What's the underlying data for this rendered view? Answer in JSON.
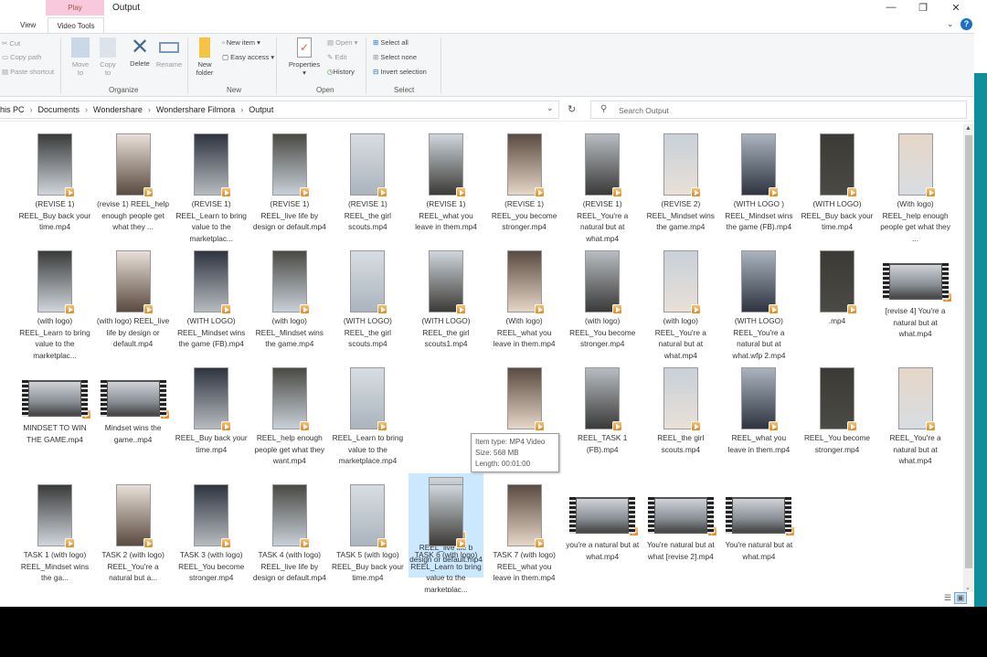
{
  "window": {
    "title": "Output",
    "contextual_group": "Play",
    "tabs": [
      "View",
      "Video Tools"
    ],
    "controls": [
      "—",
      "❐",
      "✕"
    ],
    "help": "?"
  },
  "ribbon": {
    "clipboard": {
      "cut": "Cut",
      "copy_path": "Copy path",
      "paste_shortcut": "Paste shortcut"
    },
    "organize": {
      "label": "Organize",
      "move_to": "Move to",
      "copy_to": "Copy to",
      "delete": "Delete",
      "rename": "Rename"
    },
    "new": {
      "label": "New",
      "new_folder": "New folder",
      "new_item": "New item",
      "easy_access": "Easy access"
    },
    "open": {
      "label": "Open",
      "properties": "Properties",
      "open": "Open",
      "edit": "Edit",
      "history": "History"
    },
    "select": {
      "label": "Select",
      "select_all": "Select all",
      "select_none": "Select none",
      "invert": "Invert selection"
    }
  },
  "breadcrumb": [
    "his PC",
    "Documents",
    "Wondershare",
    "Wondershare Filmora",
    "Output"
  ],
  "search": {
    "placeholder": "Search Output"
  },
  "files": [
    {
      "name": "(REVISE 1) REEL_Buy back your time.mp4",
      "thumb": "portrait"
    },
    {
      "name": "(revise 1) REEL_help enough people get what they ...",
      "thumb": "portrait"
    },
    {
      "name": "(REVISE 1) REEL_Learn to bring value to the marketplac...",
      "thumb": "portrait"
    },
    {
      "name": "(REVISE 1) REEL_live life by design or default.mp4",
      "thumb": "portrait"
    },
    {
      "name": "(REVISE 1) REEL_the girl scouts.mp4",
      "thumb": "portrait"
    },
    {
      "name": "(REVISE 1) REEL_what you leave in them.mp4",
      "thumb": "portrait"
    },
    {
      "name": "(REVISE 1) REEL_you become stronger.mp4",
      "thumb": "portrait"
    },
    {
      "name": "(REVISE 1) REEL_You're a natural but at what.mp4",
      "thumb": "portrait"
    },
    {
      "name": "(REVISE 2) REEL_Mindset wins the game.mp4",
      "thumb": "portrait"
    },
    {
      "name": "(WITH LOGO ) REEL_Mindset wins the game (FB).mp4",
      "thumb": "portrait"
    },
    {
      "name": "(WITH LOGO) REEL_Buy back your time.mp4",
      "thumb": "portrait"
    },
    {
      "name": "(With logo) REEL_help enough people get what they ...",
      "thumb": "portrait"
    },
    {
      "name": "(with logo) REEL_Learn to bring value to the marketplac...",
      "thumb": "portrait"
    },
    {
      "name": "(with logo) REEL_live life by design or default.mp4",
      "thumb": "portrait"
    },
    {
      "name": "(WITH LOGO) REEL_Mindset wins the game (FB).mp4",
      "thumb": "portrait"
    },
    {
      "name": "(with logo) REEL_Mindset wins the game.mp4",
      "thumb": "portrait"
    },
    {
      "name": "(WITH LOGO) REEL_the girl scouts.mp4",
      "thumb": "portrait"
    },
    {
      "name": "(WITH LOGO) REEL_the girl scouts1.mp4",
      "thumb": "portrait"
    },
    {
      "name": "(With logo) REEL_what you leave in them.mp4",
      "thumb": "portrait"
    },
    {
      "name": "(with logo) REEL_You become stronger.mp4",
      "thumb": "portrait"
    },
    {
      "name": "(with logo) REEL_You're a natural but at what.mp4",
      "thumb": "portrait"
    },
    {
      "name": "(WITH LOGO) REEL_You're a natural but at what.wfp 2.mp4",
      "thumb": "portrait"
    },
    {
      "name": ".mp4",
      "thumb": "portrait"
    },
    {
      "name": "[revise 4] You're a natural but at what.mp4",
      "thumb": "landscape"
    },
    {
      "name": "MINDSET TO WIN THE GAME.mp4",
      "thumb": "landscape"
    },
    {
      "name": "Mindset wins the game..mp4",
      "thumb": "landscape"
    },
    {
      "name": "REEL_Buy back your time.mp4",
      "thumb": "portrait"
    },
    {
      "name": "REEL_help enough people get what they want.mp4",
      "thumb": "portrait"
    },
    {
      "name": "REEL_Learn to bring value to the marketplace.mp4",
      "thumb": "portrait"
    },
    {
      "name": "REEL_live life b design or default.mp4",
      "thumb": "portrait",
      "selected": true
    },
    {
      "name": "",
      "thumb": "portrait"
    },
    {
      "name": "REEL_TASK 1 (FB).mp4",
      "thumb": "portrait"
    },
    {
      "name": "REEL_the girl scouts.mp4",
      "thumb": "portrait"
    },
    {
      "name": "REEL_what you leave in them.mp4",
      "thumb": "portrait"
    },
    {
      "name": "REEL_You become stronger.mp4",
      "thumb": "portrait"
    },
    {
      "name": "REEL_You're a natural but at what.mp4",
      "thumb": "portrait"
    },
    {
      "name": "TASK 1 (with logo) REEL_Mindset wins the ga...",
      "thumb": "portrait"
    },
    {
      "name": "TASK 2 (with logo) REEL_You're a natural but a...",
      "thumb": "portrait"
    },
    {
      "name": "TASK 3 (with logo) REEL_You become stronger.mp4",
      "thumb": "portrait"
    },
    {
      "name": "TASK 4 (with logo) REEL_live life by design or default.mp4",
      "thumb": "portrait"
    },
    {
      "name": "TASK 5 (with logo) REEL_Buy back your time.mp4",
      "thumb": "portrait"
    },
    {
      "name": "TASK 6 (with logo) REEL_Learn to bring value to the marketplac...",
      "thumb": "portrait"
    },
    {
      "name": "TASK 7 (with logo) REEL_what you leave in them.mp4",
      "thumb": "portrait"
    },
    {
      "name": "you're a natural but at what.mp4",
      "thumb": "landscape"
    },
    {
      "name": "You're natural but at what [revise 2].mp4",
      "thumb": "landscape"
    },
    {
      "name": "You're natural but at what.mp4",
      "thumb": "landscape"
    }
  ],
  "tooltip": {
    "type": "Item type: MP4 Video",
    "size": "Size: 568 MB",
    "length": "Length: 00:01:00"
  },
  "colors": {
    "selection": "#cce8ff",
    "accent": "#1a6fc8",
    "play_tab": "#f8c8dc"
  }
}
